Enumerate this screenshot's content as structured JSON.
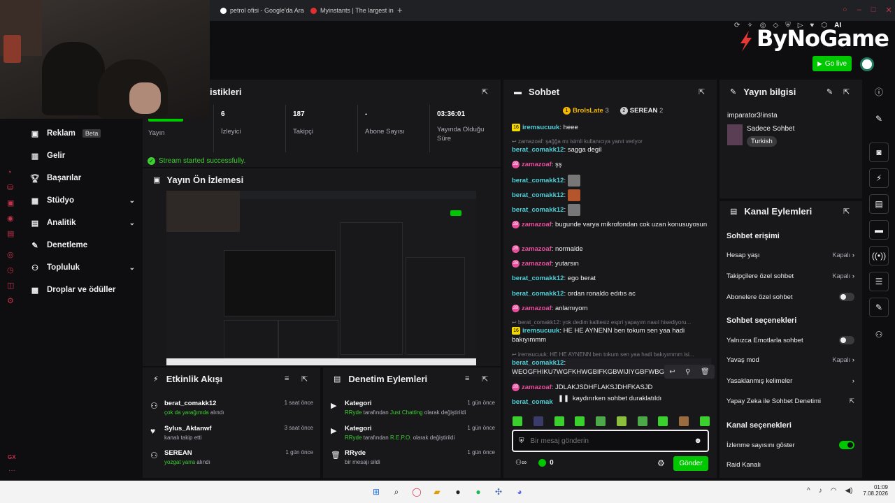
{
  "browser_tabs": [
    {
      "title": "petrol ofisi - Google'da Ara"
    },
    {
      "title": "Myinstants | The largest in"
    }
  ],
  "header": {
    "brand": "ByNoGame",
    "go_live_label": "Go live",
    "ai_label": "AI"
  },
  "sidebar": {
    "items": [
      {
        "label": "Reklam",
        "badge": "Beta"
      },
      {
        "label": "Gelir"
      },
      {
        "label": "Başarılar"
      },
      {
        "label": "Stüdyo"
      },
      {
        "label": "Analitik"
      },
      {
        "label": "Denetleme"
      },
      {
        "label": "Topluluk"
      },
      {
        "label": "Droplar ve ödüller"
      }
    ],
    "rail_footer": "GX"
  },
  "stats": {
    "title_partial": "istikleri",
    "cells": [
      {
        "value": "",
        "label": "Yayın"
      },
      {
        "value": "6",
        "label": "İzleyici"
      },
      {
        "value": "187",
        "label": "Takipçi"
      },
      {
        "value": "-",
        "label": "Abone Sayısı"
      },
      {
        "value": "03:36:01",
        "label": "Yayında Olduğu Süre"
      }
    ],
    "success_msg": "Stream started successfully."
  },
  "preview": {
    "title": "Yayın Ön İzlemesi"
  },
  "activity": {
    "title": "Etkinlik Akışı",
    "rows": [
      {
        "user": "berat_comakk12",
        "detail_highlight": "çok da yarağımda",
        "detail_rest": " alındı",
        "time": "1 saat önce"
      },
      {
        "user": "Sylus_Aktanwf",
        "detail_highlight": "",
        "detail_rest": "kanalı takip etti",
        "time": "3 saat önce"
      },
      {
        "user": "SEREAN",
        "detail_highlight": "yozgat yarra",
        "detail_rest": " alındı",
        "time": "1 gün önce"
      }
    ]
  },
  "moderation": {
    "title": "Denetim Eylemleri",
    "rows": [
      {
        "title": "Kategori",
        "actor": "RRyde",
        "mid": " tarafından ",
        "target": "Just Chatting",
        "end": " olarak değiştirildi",
        "time": "1 gün önce"
      },
      {
        "title": "Kategori",
        "actor": "RRyde",
        "mid": " tarafından ",
        "target": "R.E.P.O.",
        "end": " olarak değiştirildi",
        "time": "1 gün önce"
      },
      {
        "title": "RRyde",
        "actor": "",
        "mid": "bir mesajı sildi",
        "target": "",
        "end": "",
        "time": "1 gün önce"
      }
    ]
  },
  "chat": {
    "title": "Sohbet",
    "top_users": [
      {
        "rank": "1",
        "name": "BrolsLate",
        "count": "3"
      },
      {
        "rank": "2",
        "name": "SEREAN",
        "count": "2"
      }
    ],
    "messages": [
      {
        "badge": "16",
        "user": "iremsucuuk",
        "text": "heee",
        "color": "cyan"
      },
      {
        "reply": "zamazoaf: şağğa mı isimli kullanıcıya yanıt veriyor"
      },
      {
        "user": "berat_comakk12",
        "text": "sagga degil",
        "color": "cyan"
      },
      {
        "badge": "2B",
        "user": "zamazoaf",
        "text": "şş",
        "color": "pink"
      },
      {
        "user": "berat_comakk12",
        "text": "",
        "emote": true,
        "color": "cyan"
      },
      {
        "user": "berat_comakk12",
        "text": "",
        "emote": true,
        "color": "cyan"
      },
      {
        "user": "berat_comakk12",
        "text": "",
        "emote": true,
        "color": "cyan"
      },
      {
        "badge": "2B",
        "user": "zamazoaf",
        "text": "bugunde varya mikrofondan cok uzan konusuyosun",
        "color": "pink"
      },
      {
        "badge": "2B",
        "user": "zamazoaf",
        "text": "normalde",
        "color": "pink"
      },
      {
        "badge": "2B",
        "user": "zamazoaf",
        "text": "yutarsın",
        "color": "pink"
      },
      {
        "user": "berat_comakk12",
        "text": "ego berat",
        "color": "cyan"
      },
      {
        "user": "berat_comakk12",
        "text": "ordan ronaldo edıtıs ac",
        "color": "cyan"
      },
      {
        "badge": "2B",
        "user": "zamazoaf",
        "text": "anlamıyom",
        "color": "pink"
      },
      {
        "reply": "berat_comakk12: yok dedim kalitesiz espri yapayım nasıl hisediyoru..."
      },
      {
        "badge": "16",
        "user": "iremsucuuk",
        "text": "HE HE AYNENN ben tokum sen yaa hadi bakıyımmm",
        "color": "cyan"
      },
      {
        "reply": "iremsucuuk: HE HE AYNENN ben tokum sen yaa hadi bakıyımmm isi..."
      },
      {
        "user": "berat_comakk12",
        "text": "WEOGFHIKU7WGFKHWGBIFKGBWIJIYGBFWBGU",
        "color": "cyan"
      },
      {
        "badge": "2B",
        "user": "zamazoaf",
        "text": "JDLAKJSDHFLAKSJDHFKASJD",
        "color": "pink"
      },
      {
        "user": "berat_comak",
        "text": "",
        "color": "cyan"
      }
    ],
    "paused_msg": "kaydırırken sohbet duraklatıldı",
    "input_placeholder": "Bir mesaj gönderin",
    "points": "0",
    "send_label": "Gönder"
  },
  "stream_info": {
    "title": "Yayın bilgisi",
    "stream_title": "imparator3!insta",
    "category": "Sadece Sohbet",
    "tag": "Turkish"
  },
  "channel_actions": {
    "title": "Kanal Eylemleri",
    "sections": [
      {
        "title": "Sohbet erişimi"
      },
      {
        "title": "Sohbet seçenekleri"
      },
      {
        "title": "Kanal seçenekleri"
      }
    ],
    "rows": [
      {
        "label": "Hesap yaşı",
        "value": "Kapalı",
        "kind": "chevron"
      },
      {
        "label": "Takipçilere özel sohbet",
        "value": "Kapalı",
        "kind": "chevron"
      },
      {
        "label": "Abonelere özel sohbet",
        "value": "",
        "kind": "toggle-off"
      },
      {
        "label": "Yalnızca Emotlarla sohbet",
        "value": "",
        "kind": "toggle-off"
      },
      {
        "label": "Yavaş mod",
        "value": "Kapalı",
        "kind": "chevron"
      },
      {
        "label": "Yasaklanmış kelimeler",
        "value": "",
        "kind": "chevron"
      },
      {
        "label": "Yapay Zeka ile Sohbet Denetimi",
        "value": "",
        "kind": "external"
      },
      {
        "label": "İzlenme sayısını göster",
        "value": "",
        "kind": "toggle-on"
      },
      {
        "label": "Raid Kanalı",
        "value": "",
        "kind": "none"
      }
    ]
  },
  "taskbar": {
    "time": "01:09",
    "date": "7.08.2026"
  },
  "colors": {
    "bg": "#0e0e10",
    "panel": "#18181b",
    "accent_green": "#00c800",
    "username_cyan": "#4fd1d9",
    "username_pink": "#e94e9d"
  }
}
